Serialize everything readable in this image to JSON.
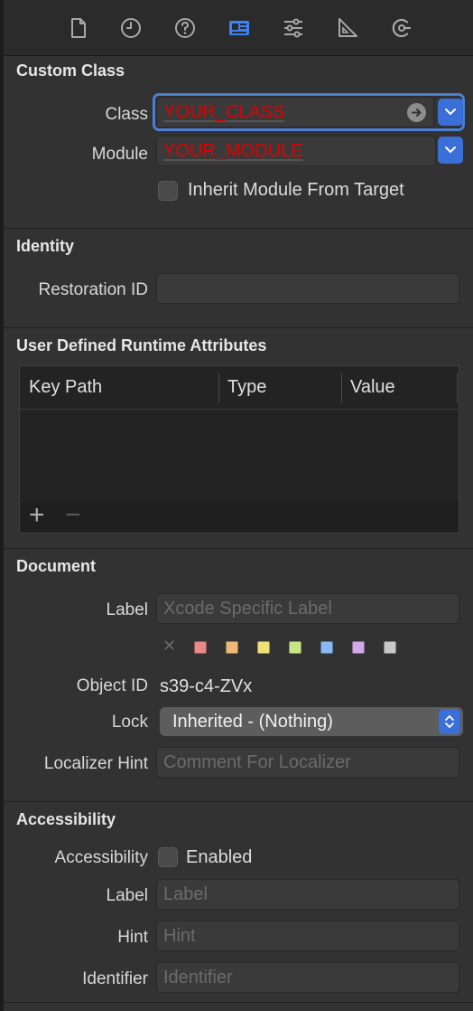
{
  "toolbar": {
    "icons": [
      {
        "name": "file-inspector-icon"
      },
      {
        "name": "history-inspector-icon"
      },
      {
        "name": "quick-help-icon"
      },
      {
        "name": "identity-inspector-icon",
        "selected": true
      },
      {
        "name": "attributes-inspector-icon"
      },
      {
        "name": "size-inspector-icon"
      },
      {
        "name": "connections-inspector-icon"
      }
    ],
    "accent": "#3b82f6"
  },
  "custom_class": {
    "title": "Custom Class",
    "class_label": "Class",
    "class_value": "YOUR_CLASS",
    "module_label": "Module",
    "module_value": "YOUR_MODULE",
    "inherit_label": "Inherit Module From Target"
  },
  "identity": {
    "title": "Identity",
    "restoration_label": "Restoration ID",
    "restoration_value": ""
  },
  "runtime_attributes": {
    "title": "User Defined Runtime Attributes",
    "columns": [
      "Key Path",
      "Type",
      "Value"
    ],
    "add_label": "+",
    "remove_label": "−"
  },
  "document": {
    "title": "Document",
    "label_label": "Label",
    "label_placeholder": "Xcode Specific Label",
    "clear_label": "✕",
    "swatch_colors": [
      "#e98a8a",
      "#f0b878",
      "#eee07a",
      "#c9e58a",
      "#8ab8f0",
      "#d3a8e8",
      "#c8c8c8"
    ],
    "object_id_label": "Object ID",
    "object_id_value": "s39-c4-ZVx",
    "lock_label": "Lock",
    "lock_value": "Inherited - (Nothing)",
    "localizer_label": "Localizer Hint",
    "localizer_placeholder": "Comment For Localizer"
  },
  "accessibility": {
    "title": "Accessibility",
    "accessibility_label": "Accessibility",
    "enabled_label": "Enabled",
    "label_label": "Label",
    "label_placeholder": "Label",
    "hint_label": "Hint",
    "hint_placeholder": "Hint",
    "identifier_label": "Identifier",
    "identifier_placeholder": "Identifier"
  }
}
